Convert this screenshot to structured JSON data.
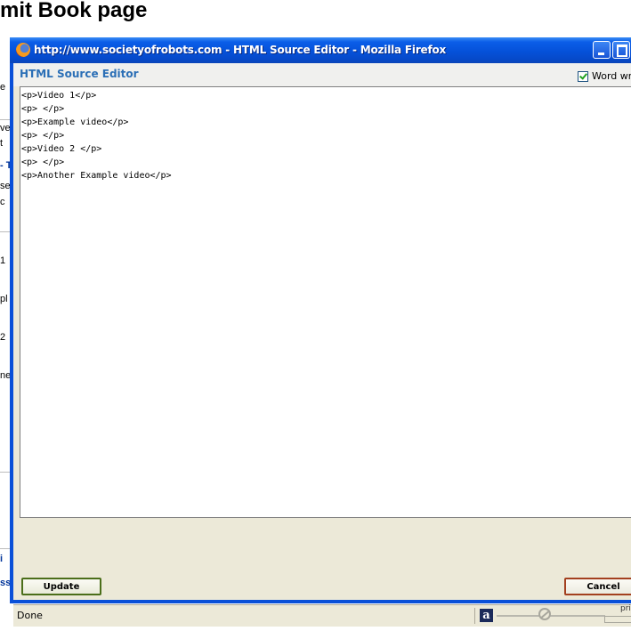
{
  "background": {
    "page_title": "mit Book page",
    "left_fragments": [
      "e",
      "ve",
      "t",
      "- T",
      "se",
      "c",
      "1",
      "pl",
      "2",
      "ne",
      "i",
      "ss"
    ]
  },
  "window": {
    "title": "http://www.societyofrobots.com - HTML Source Editor - Mozilla Firefox",
    "editor_title": "HTML Source Editor",
    "word_wrap_label": "Word wr",
    "word_wrap_checked": true,
    "source_code": "<p>Video 1</p>\n<p> </p>\n<p>Example video</p>\n<p> </p>\n<p>Video 2 </p>\n<p> </p>\n<p>Another Example video</p>",
    "update_label": "Update",
    "cancel_label": "Cancel",
    "status_text": "Done",
    "status_fragment": "pri",
    "alexa_letter": "a"
  },
  "colors": {
    "titlebar": "#0551d9",
    "editor_title": "#2b6fb6",
    "update_border": "#4b6e1a",
    "cancel_border": "#a3401f"
  }
}
